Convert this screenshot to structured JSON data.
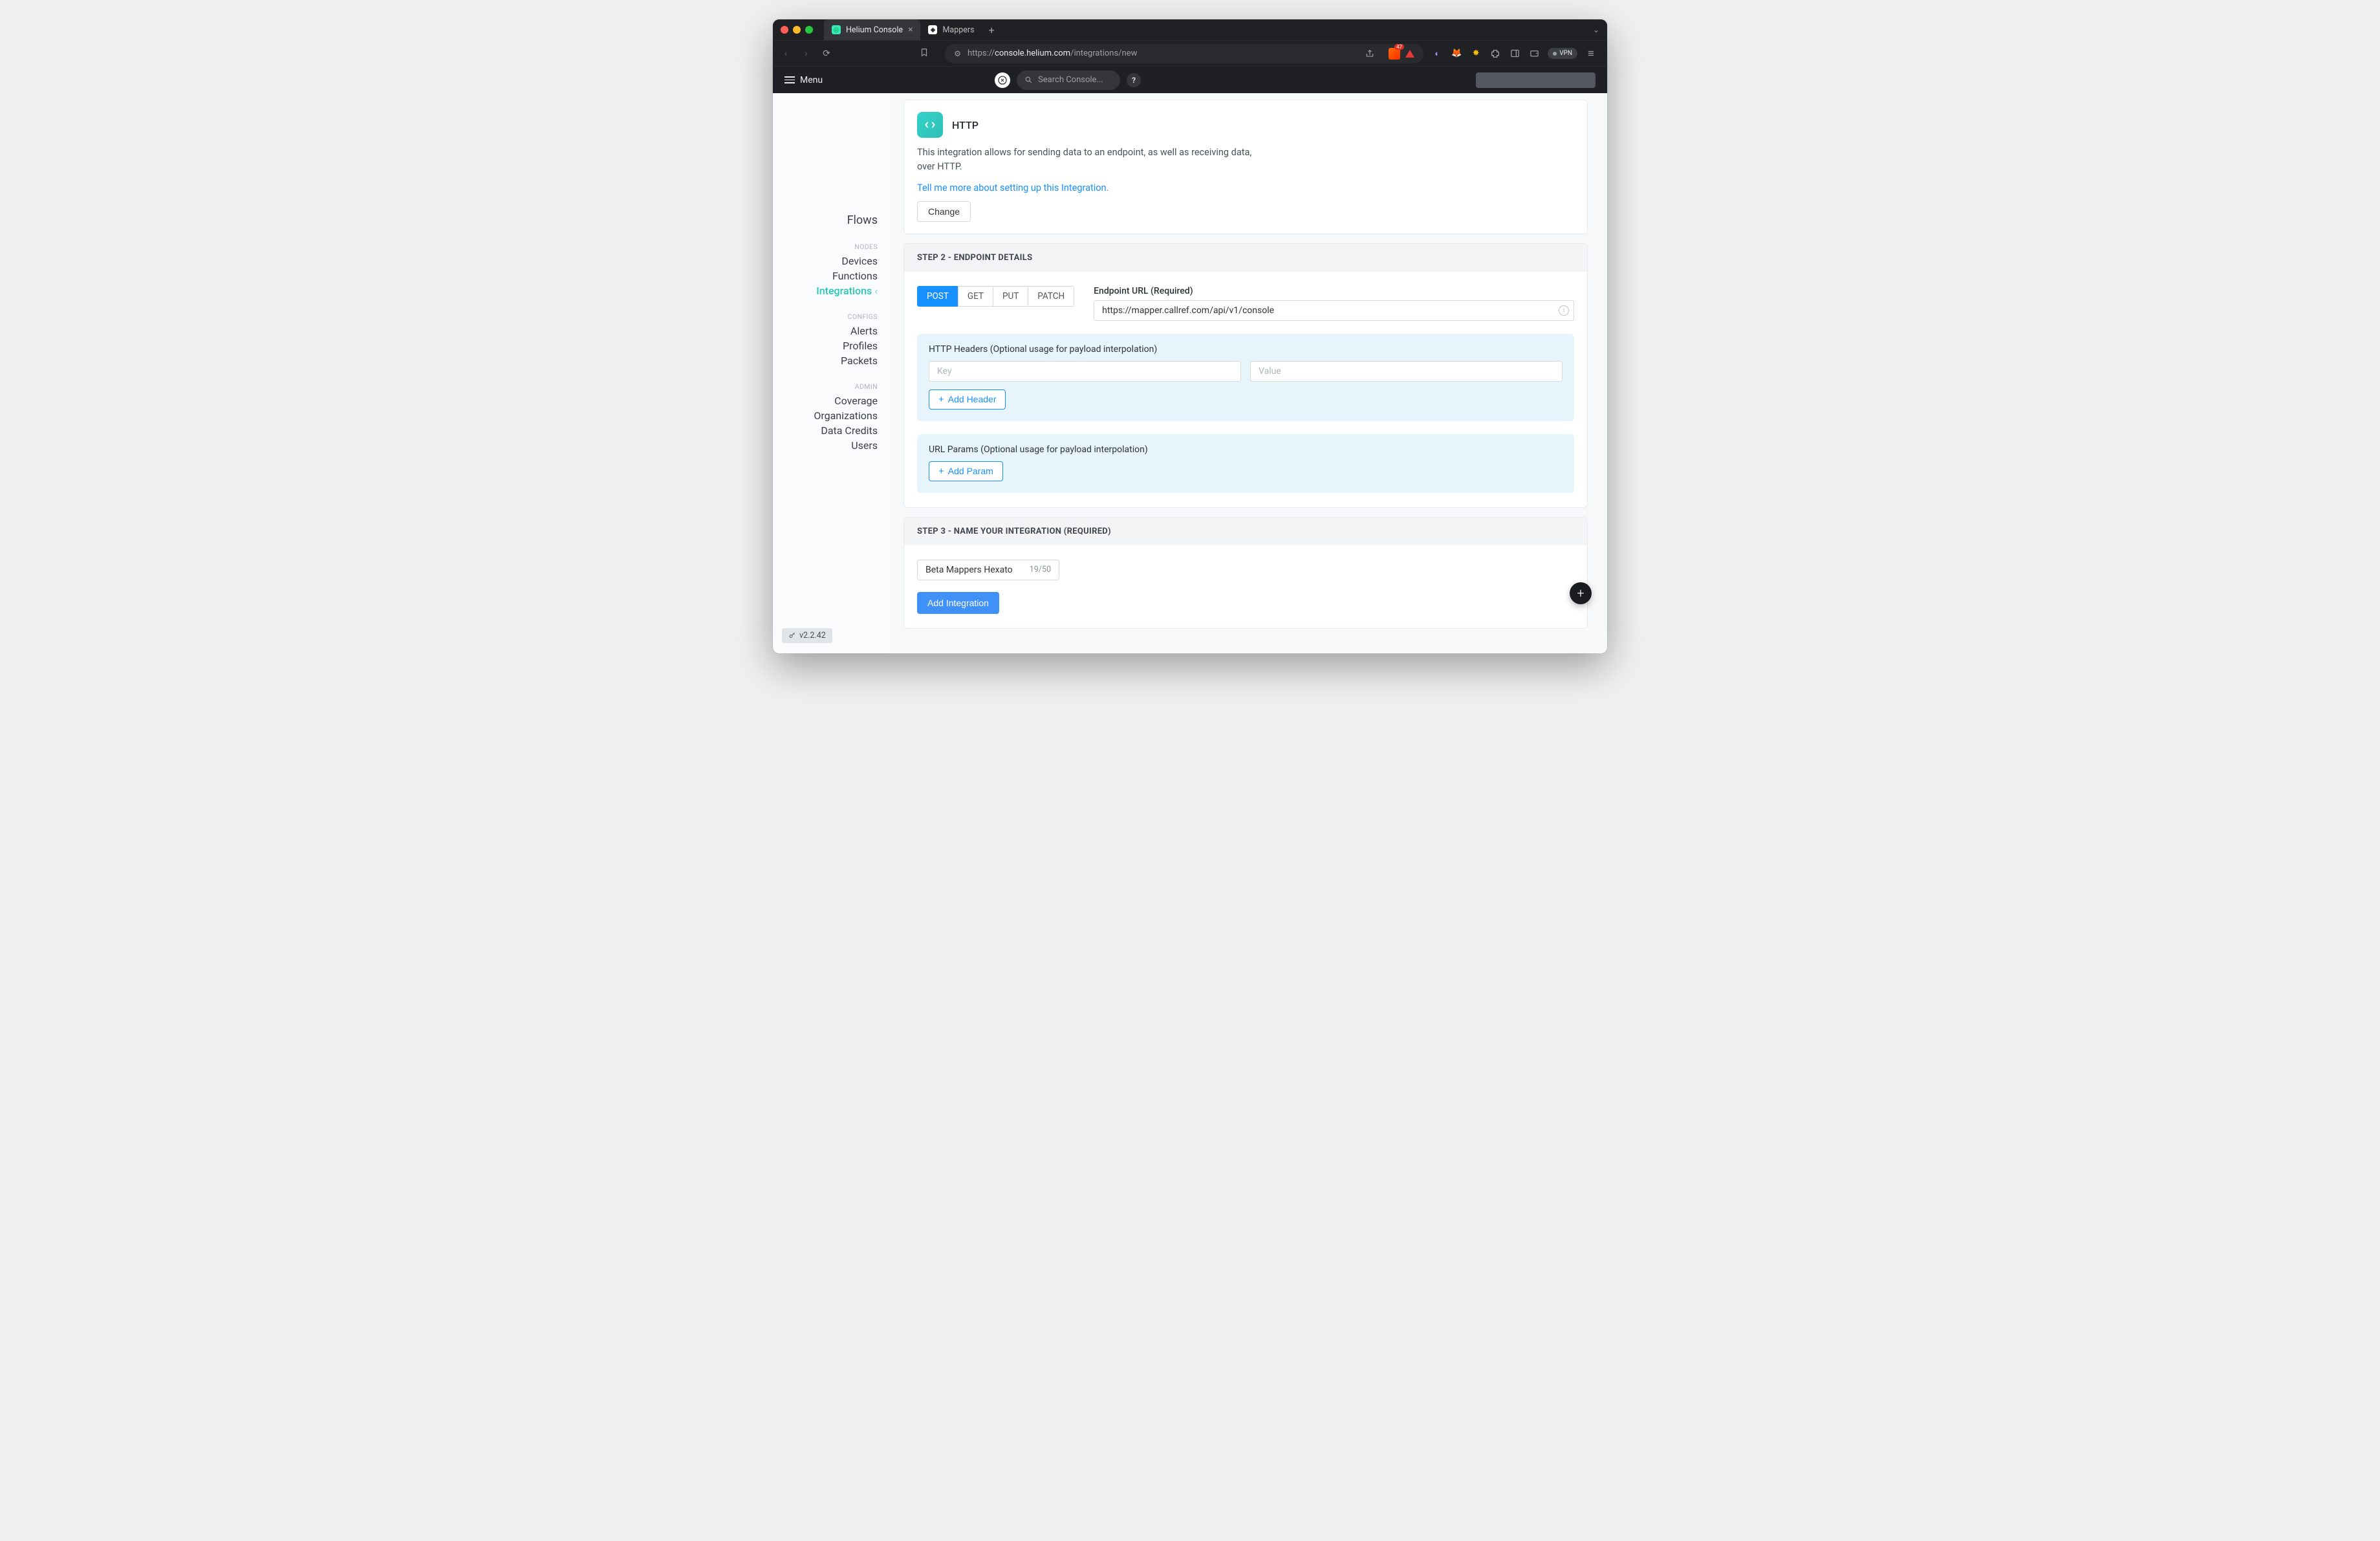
{
  "browser": {
    "tabs": [
      {
        "title": "Helium Console",
        "active": true
      },
      {
        "title": "Mappers",
        "active": false
      }
    ],
    "url_host": "console.helium.com",
    "url_path": "/integrations/new",
    "vpn_label": "VPN",
    "brave_badge": "47"
  },
  "appheader": {
    "menu_label": "Menu",
    "search_placeholder": "Search Console...",
    "help_label": "?"
  },
  "sidebar": {
    "flows": "Flows",
    "nodes_label": "NODES",
    "nodes": {
      "devices": "Devices",
      "functions": "Functions",
      "integrations": "Integrations"
    },
    "configs_label": "CONFIGS",
    "configs": {
      "alerts": "Alerts",
      "profiles": "Profiles",
      "packets": "Packets"
    },
    "admin_label": "ADMIN",
    "admin": {
      "coverage": "Coverage",
      "organizations": "Organizations",
      "data_credits": "Data Credits",
      "users": "Users"
    },
    "version": "v2.2.42"
  },
  "integration_intro": {
    "title": "HTTP",
    "description": "This integration allows for sending data to an endpoint, as well as receiving data, over HTTP.",
    "link_text": "Tell me more about setting up this Integration.",
    "change_label": "Change"
  },
  "step2": {
    "header": "STEP 2 - ENDPOINT DETAILS",
    "methods": {
      "post": "POST",
      "get": "GET",
      "put": "PUT",
      "patch": "PATCH"
    },
    "endpoint_label": "Endpoint URL (Required)",
    "endpoint_value": "https://mapper.callref.com/api/v1/console",
    "headers_label": "HTTP Headers (Optional usage for payload interpolation)",
    "header_key_placeholder": "Key",
    "header_value_placeholder": "Value",
    "add_header_label": "Add Header",
    "params_label": "URL Params (Optional usage for payload interpolation)",
    "add_param_label": "Add Param"
  },
  "step3": {
    "header": "STEP 3 - NAME YOUR INTEGRATION (REQUIRED)",
    "name_value": "Beta Mappers Hexato",
    "name_counter": "19/50",
    "submit_label": "Add Integration"
  },
  "fab_label": "+"
}
